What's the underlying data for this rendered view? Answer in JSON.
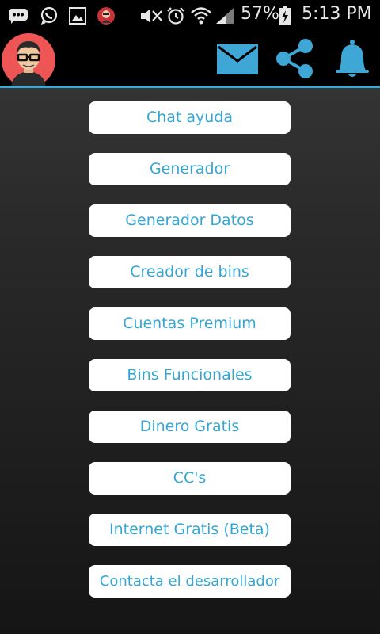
{
  "status_bar": {
    "battery_percent": "57%",
    "time": "5:13 PM",
    "left_icons": [
      "chat-icon",
      "whatsapp-icon",
      "image-icon",
      "app-notification-icon"
    ],
    "right_icons": [
      "mute-icon",
      "alarm-icon",
      "wifi-icon",
      "signal-icon",
      "battery-icon"
    ]
  },
  "app_bar": {
    "avatar_icon": "user-avatar",
    "actions": [
      {
        "icon": "mail-icon"
      },
      {
        "icon": "share-icon"
      },
      {
        "icon": "bell-icon"
      }
    ],
    "accent_color": "#3fa7d6"
  },
  "menu": {
    "items": [
      {
        "label": "Chat ayuda"
      },
      {
        "label": "Generador"
      },
      {
        "label": "Generador Datos"
      },
      {
        "label": "Creador de bins"
      },
      {
        "label": "Cuentas Premium"
      },
      {
        "label": "Bins Funcionales"
      },
      {
        "label": "Dinero Gratis"
      },
      {
        "label": "CC's"
      },
      {
        "label": "Internet Gratis (Beta)"
      },
      {
        "label": "Contacta el desarrollador"
      }
    ],
    "text_color": "#35a6d4"
  }
}
